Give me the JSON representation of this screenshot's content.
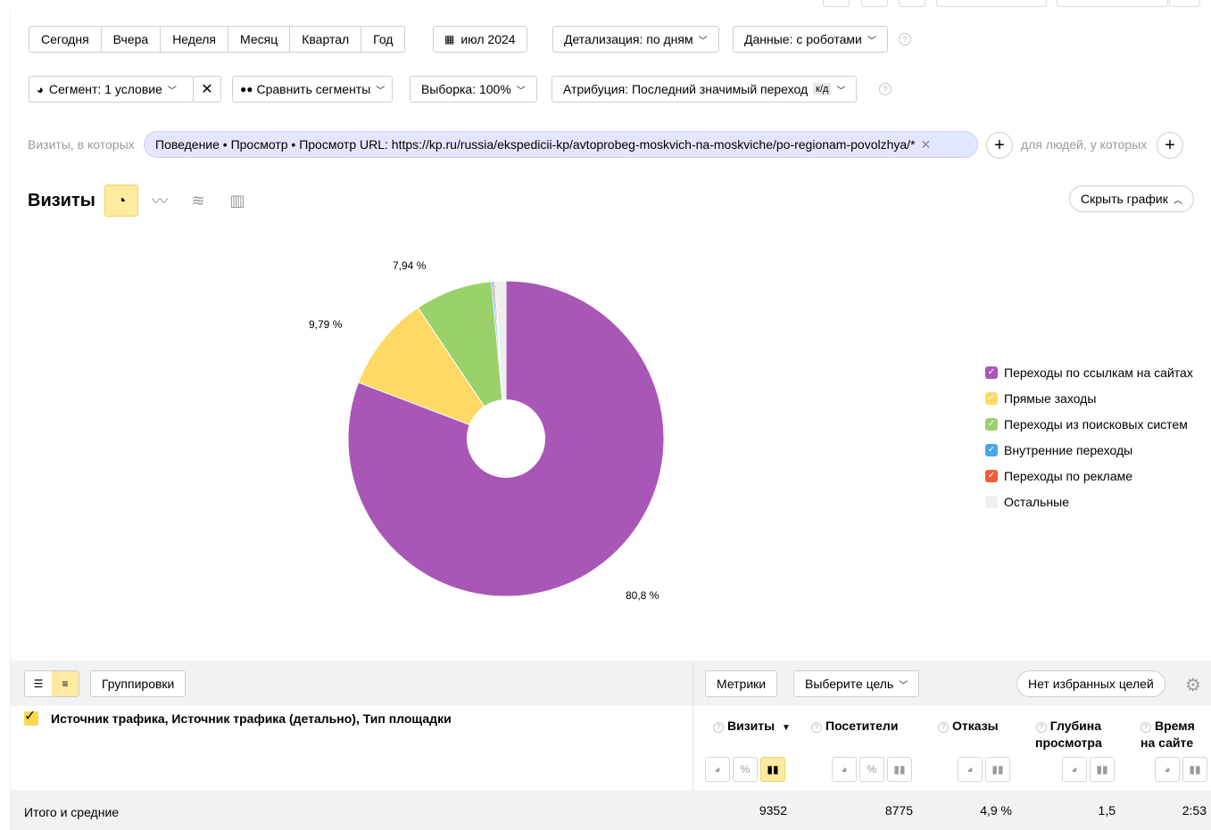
{
  "period_buttons": [
    "Сегодня",
    "Вчера",
    "Неделя",
    "Месяц",
    "Квартал",
    "Год"
  ],
  "calendar_label": "июл 2024",
  "detalization": "Детализация: по дням",
  "data_mode": "Данные: с роботами",
  "segment": "Сегмент: 1 условие",
  "compare": "Сравнить сегменты",
  "sample": "Выборка: 100%",
  "attribution": "Атрибуция: Последний значимый переход",
  "attribution_badge": "к/д",
  "filter": {
    "visits_label": "Визиты, в которых",
    "chip": "Поведение • Просмотр • Просмотр URL: https://kp.ru/russia/ekspedicii-kp/avtoprobeg-moskvich-na-moskviche/po-regionam-povolzhya/*",
    "people_label": "для людей, у которых"
  },
  "chart_header": {
    "title": "Визиты",
    "hide_chart": "Скрыть график"
  },
  "chart_data": {
    "type": "pie",
    "donut": true,
    "categories": [
      "Переходы по ссылкам на сайтах",
      "Прямые заходы",
      "Переходы из поисковых систем",
      "Внутренние переходы",
      "Переходы по рекламе",
      "Остальные"
    ],
    "values": [
      80.8,
      9.79,
      7.94,
      0.2,
      0.15,
      1.12
    ],
    "value_labels": [
      "80,8 %",
      "9,79 %",
      "7,94 %",
      "",
      "",
      ""
    ],
    "colors": [
      "#a957b7",
      "#ffd966",
      "#9bd16a",
      "#4aa8e8",
      "#f25a3c",
      "#eeeeee"
    ],
    "legend_position": "right"
  },
  "table_toolbar": {
    "groupings": "Группировки",
    "metrics": "Метрики",
    "goal": "Выберите цель",
    "favorites": "Нет избранных целей"
  },
  "table": {
    "dimension_header": "Источник трафика, Источник трафика (детально), Тип площадки",
    "columns": [
      {
        "line1": "Визиты",
        "line2": "",
        "sort": "▼"
      },
      {
        "line1": "Посетители",
        "line2": "",
        "sort": ""
      },
      {
        "line1": "Отказы",
        "line2": "",
        "sort": ""
      },
      {
        "line1": "Глубина",
        "line2": "просмотра",
        "sort": ""
      },
      {
        "line1": "Время",
        "line2": "на сайте",
        "sort": ""
      }
    ],
    "totals_label": "Итого и средние",
    "totals": [
      "9352",
      "8775",
      "4,9 %",
      "1,5",
      "2:53"
    ]
  },
  "icons": {
    "calendar": "calendar-icon",
    "segment": "segment-pie-icon",
    "compare": "compare-drops-icon",
    "pie": "pie-chart-icon",
    "line": "line-chart-icon",
    "area": "area-chart-icon",
    "bar": "bar-chart-icon",
    "gear": "gear-icon"
  }
}
